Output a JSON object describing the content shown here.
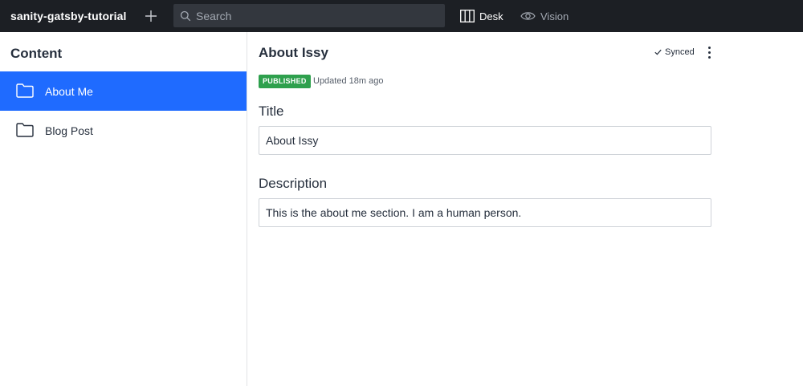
{
  "topbar": {
    "brand": "sanity-gatsby-tutorial",
    "new_document_icon": "plus-icon",
    "search": {
      "placeholder": "Search",
      "value": ""
    },
    "tools": [
      {
        "label": "Desk",
        "icon": "columns-icon",
        "active": true
      },
      {
        "label": "Vision",
        "icon": "eye-icon",
        "active": false
      }
    ]
  },
  "content_pane": {
    "title": "Content",
    "items": [
      {
        "label": "About Me",
        "icon": "folder-icon",
        "selected": true
      },
      {
        "label": "Blog Post",
        "icon": "folder-icon",
        "selected": false
      }
    ]
  },
  "document": {
    "title": "About Issy",
    "sync_status": "Synced",
    "status_badge": "PUBLISHED",
    "updated": "Updated 18m ago",
    "fields": [
      {
        "label": "Title",
        "value": "About Issy"
      },
      {
        "label": "Description",
        "value": "This is the about me section. I am a human person."
      }
    ]
  },
  "colors": {
    "topbar_bg": "#1c1f24",
    "accent": "#1f6bff",
    "published": "#2ea04d"
  }
}
